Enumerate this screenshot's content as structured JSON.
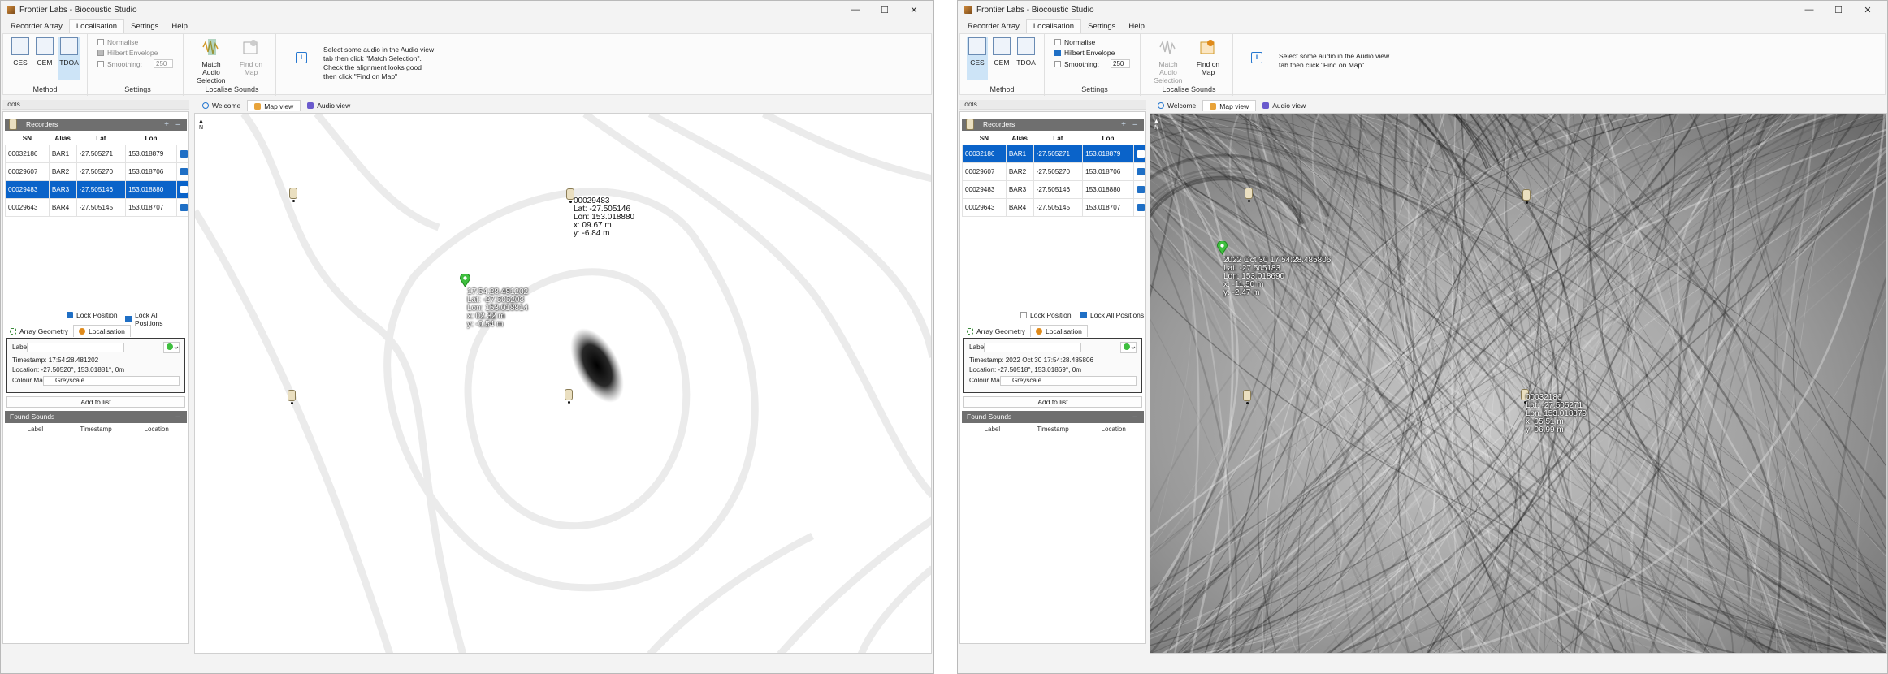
{
  "windowA": {
    "title": "Frontier Labs - Biocoustic Studio",
    "menu": [
      "Recorder Array",
      "Localisation",
      "Settings",
      "Help"
    ],
    "ribbon": {
      "method_buttons": [
        "CES",
        "CEM",
        "TDOA"
      ],
      "method_label": "Method",
      "settings": {
        "normalise": "Normalise",
        "hilbert": "Hilbert Envelope",
        "smoothing": "Smoothing:",
        "smoothing_value": "250"
      },
      "settings_label": "Settings",
      "match_label": "Match Audio Selection",
      "find_label": "Find on Map",
      "localise_label": "Localise Sounds",
      "info_lines": [
        "Select some audio in the Audio view",
        "tab then click \"Match Selection\".",
        "Check the alignment looks good",
        "then click \"Find on Map\""
      ]
    },
    "tools_label": "Tools",
    "recorders_label": "Recorders",
    "table": {
      "headers": [
        "SN",
        "Alias",
        "Lat",
        "Lon"
      ],
      "rows": [
        {
          "sn": "00032186",
          "alias": "BAR1",
          "lat": "-27.505271",
          "lon": "153.018879"
        },
        {
          "sn": "00029607",
          "alias": "BAR2",
          "lat": "-27.505270",
          "lon": "153.018706"
        },
        {
          "sn": "00029483",
          "alias": "BAR3",
          "lat": "-27.505146",
          "lon": "153.018880"
        },
        {
          "sn": "00029643",
          "alias": "BAR4",
          "lat": "-27.505145",
          "lon": "153.018707"
        }
      ]
    },
    "lock_position": "Lock Position",
    "lock_all": "Lock All Positions",
    "tab_geometry": "Array Geometry",
    "tab_localisation": "Localisation",
    "loc": {
      "label": "Label:",
      "timestamp": "Timestamp:  17:54:28.481202",
      "location": "Location:  -27.50520°, 153.01881°, 0m",
      "colour_map": "Colour Map:",
      "colour_value": "Greyscale",
      "add": "Add to list"
    },
    "found_sounds": "Found Sounds",
    "found_headers": [
      "Label",
      "Timestamp",
      "Location"
    ],
    "doc_tabs": [
      "Welcome",
      "Map view",
      "Audio view"
    ],
    "compass": "N",
    "map_label_recorder": "00029483\nLat: -27.505146\nLon: 153.018880\nx: 09.67 m\ny: -6.84 m",
    "map_label_source": "17:54:28.481202\nLat: -27.505203\nLon: 153.018814\nx: 02.32 m\ny: -0.54 m"
  },
  "windowB": {
    "title": "Frontier Labs - Biocoustic Studio",
    "menu": [
      "Recorder Array",
      "Localisation",
      "Settings",
      "Help"
    ],
    "ribbon": {
      "method_buttons": [
        "CES",
        "CEM",
        "TDOA"
      ],
      "method_label": "Method",
      "settings": {
        "normalise": "Normalise",
        "hilbert": "Hilbert Envelope",
        "smoothing": "Smoothing:",
        "smoothing_value": "250"
      },
      "settings_label": "Settings",
      "match_label": "Match Audio Selection",
      "find_label": "Find on Map",
      "localise_label": "Localise Sounds",
      "info_lines": [
        "Select some audio in the Audio view",
        "tab then click \"Find on Map\""
      ]
    },
    "tools_label": "Tools",
    "recorders_label": "Recorders",
    "table": {
      "headers": [
        "SN",
        "Alias",
        "Lat",
        "Lon"
      ],
      "rows": [
        {
          "sn": "00032186",
          "alias": "BAR1",
          "lat": "-27.505271",
          "lon": "153.018879"
        },
        {
          "sn": "00029607",
          "alias": "BAR2",
          "lat": "-27.505270",
          "lon": "153.018706"
        },
        {
          "sn": "00029483",
          "alias": "BAR3",
          "lat": "-27.505146",
          "lon": "153.018880"
        },
        {
          "sn": "00029643",
          "alias": "BAR4",
          "lat": "-27.505145",
          "lon": "153.018707"
        }
      ]
    },
    "lock_position": "Lock Position",
    "lock_all": "Lock All Positions",
    "tab_geometry": "Array Geometry",
    "tab_localisation": "Localisation",
    "loc": {
      "label": "Label:",
      "timestamp": "Timestamp:  2022 Oct 30 17:54:28.485806",
      "location": "Location:  -27.50518°, 153.01869°, 0m",
      "colour_map": "Colour Map:",
      "colour_value": "Greyscale",
      "add": "Add to list"
    },
    "found_sounds": "Found Sounds",
    "found_headers": [
      "Label",
      "Timestamp",
      "Location"
    ],
    "doc_tabs": [
      "Welcome",
      "Map view",
      "Audio view"
    ],
    "compass": "N",
    "map_label_source": "2022 Oct 30 17:54:28.485806\nLat: -27.505183\nLon: 153.018690\nx: -11.50 m\ny: -2.47 m",
    "map_label_recorder": "00032186\nLat: -27.505271\nLon: 153.018879\nx: 05.51 m\ny: 06.99 m"
  },
  "colors": {
    "selected_row": "#0a63c9",
    "pin_green": "#3fbf3f",
    "accent": "#1f6fc5"
  }
}
